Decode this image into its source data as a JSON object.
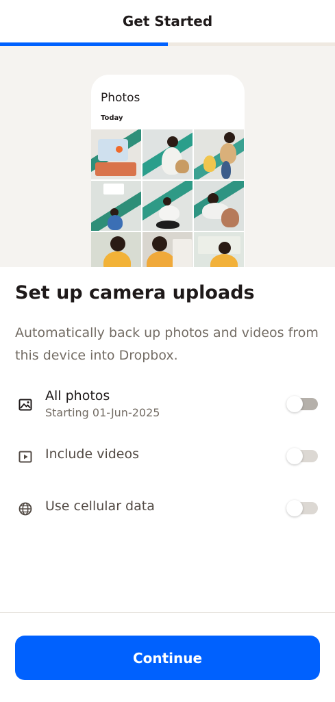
{
  "header": {
    "title": "Get Started"
  },
  "progress": {
    "value": 0.5,
    "fill_color": "#0061fe",
    "track_color": "#efe9e1"
  },
  "hero": {
    "phone_title": "Photos",
    "phone_subtitle": "Today"
  },
  "main": {
    "title": "Set up camera uploads",
    "description": "Automatically back up photos and videos from this device into Dropbox."
  },
  "options": [
    {
      "label": "All photos",
      "sublabel": "Starting 01-Jun-2025",
      "icon": "photo-icon",
      "enabled": false
    },
    {
      "label": "Include videos",
      "icon": "video-icon",
      "enabled": false
    },
    {
      "label": "Use cellular data",
      "icon": "globe-icon",
      "enabled": false
    }
  ],
  "footer": {
    "continue_label": "Continue",
    "accent": "#0061fe"
  }
}
